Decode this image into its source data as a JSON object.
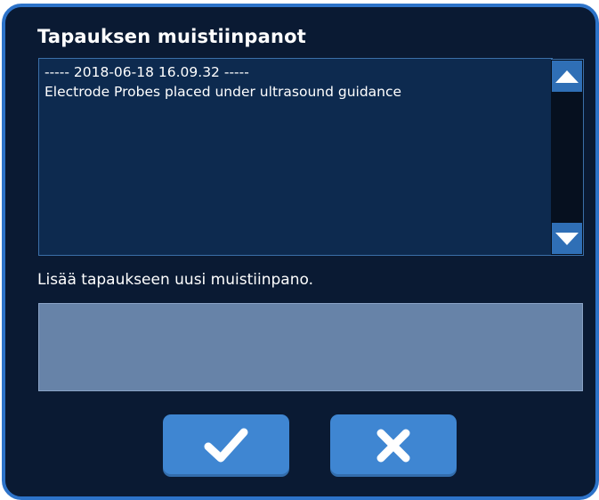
{
  "dialog": {
    "title": "Tapauksen muistiinpanot",
    "notes": {
      "lines": [
        "----- 2018-06-18 16.09.32 -----",
        "Electrode Probes placed under ultrasound guidance"
      ]
    },
    "scrollbar": {
      "up_icon": "triangle-up-icon",
      "down_icon": "triangle-down-icon"
    },
    "add_note_label": "Lisää tapaukseen uusi muistiinpano.",
    "new_note_input": {
      "value": "",
      "placeholder": ""
    },
    "buttons": {
      "confirm_icon": "checkmark-icon",
      "cancel_icon": "x-icon"
    },
    "colors": {
      "background": "#0a1a33",
      "border_accent": "#2d73c9",
      "notes_background": "#0d2a4f",
      "input_background": "#6783a8",
      "button": "#3f86d2",
      "text": "#ffffff"
    }
  }
}
